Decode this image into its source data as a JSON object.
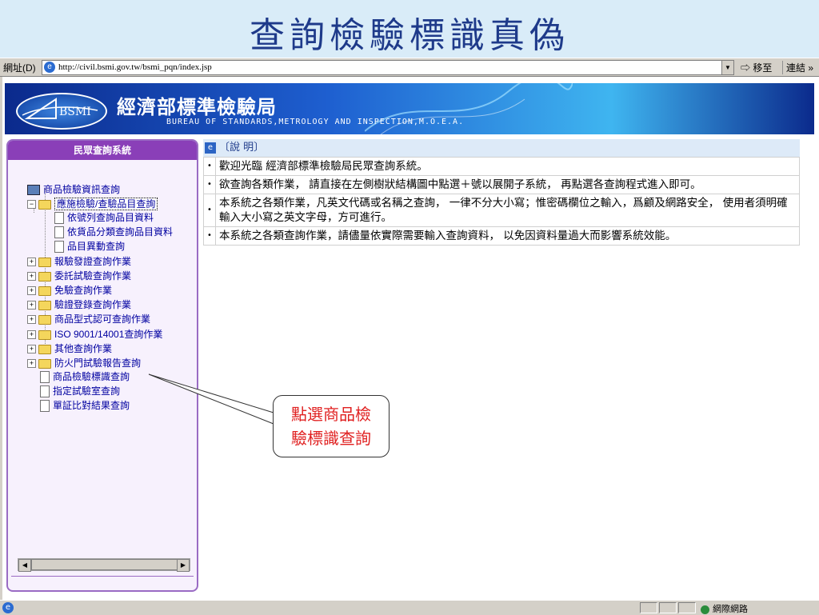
{
  "slide": {
    "title": "查詢檢驗標識真偽"
  },
  "browser": {
    "address_label": "網址(D)",
    "url": "http://civil.bsmi.gov.tw/bsmi_pqn/index.jsp",
    "go_label": "移至",
    "links_label": "連結",
    "chevron": "»",
    "status_zone": "網際網路"
  },
  "banner": {
    "logo_text": "BSMI",
    "title_zh": "經濟部標準檢驗局",
    "title_en": "BUREAU OF STANDARDS,METROLOGY AND INSPECTION,M.O.E.A."
  },
  "sidebar": {
    "header": "民眾查詢系統",
    "items": [
      {
        "label": "商品檢驗資訊查詢",
        "icon": "computer-icon"
      },
      {
        "label": "應施檢驗/查驗品目查詢",
        "icon": "folder-open-icon",
        "expander": "−"
      },
      {
        "label": "依號列查詢品目資料",
        "icon": "document-icon"
      },
      {
        "label": "依貨品分類查詢品目資料",
        "icon": "document-icon"
      },
      {
        "label": "品目異動查詢",
        "icon": "document-icon"
      },
      {
        "label": "報驗發證查詢作業",
        "icon": "folder-icon",
        "expander": "+"
      },
      {
        "label": "委託試驗查詢作業",
        "icon": "folder-icon",
        "expander": "+"
      },
      {
        "label": "免驗查詢作業",
        "icon": "folder-icon",
        "expander": "+"
      },
      {
        "label": "驗證登錄查詢作業",
        "icon": "folder-icon",
        "expander": "+"
      },
      {
        "label": "商品型式認可查詢作業",
        "icon": "folder-icon",
        "expander": "+"
      },
      {
        "label": "ISO 9001/14001查詢作業",
        "icon": "folder-icon",
        "expander": "+"
      },
      {
        "label": "其他查詢作業",
        "icon": "folder-icon",
        "expander": "+"
      },
      {
        "label": "防火門試驗報告查詢",
        "icon": "folder-icon",
        "expander": "+"
      },
      {
        "label": "商品檢驗標識查詢",
        "icon": "document-icon"
      },
      {
        "label": "指定試驗室查詢",
        "icon": "document-icon"
      },
      {
        "label": "單証比對結果查詢",
        "icon": "document-icon"
      }
    ]
  },
  "info": {
    "heading": "〔說 明〕",
    "bullet": "•",
    "rows": [
      "歡迎光臨 經濟部標準檢驗局民眾查詢系統。",
      "欲查詢各類作業， 請直接在左側樹狀結構圖中點選＋號以展開子系統， 再點選各查詢程式進入即可。",
      "本系統之各類作業，凡英文代碼或名稱之查詢， 一律不分大小寫；惟密碼欄位之輸入，爲顧及網路安全， 使用者須明確輸入大小寫之英文字母，方可進行。",
      "本系統之各類查詢作業，請儘量依實際需要輸入查詢資料， 以免因資料量過大而影響系統效能。"
    ]
  },
  "callout": {
    "line1": "點選商品檢",
    "line2": "驗標識查詢"
  }
}
